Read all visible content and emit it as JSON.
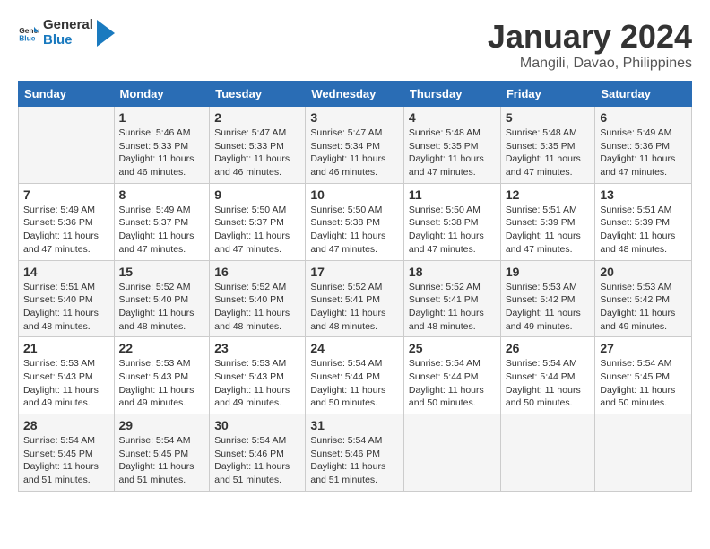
{
  "logo": {
    "text_general": "General",
    "text_blue": "Blue"
  },
  "title": "January 2024",
  "subtitle": "Mangili, Davao, Philippines",
  "days_of_week": [
    "Sunday",
    "Monday",
    "Tuesday",
    "Wednesday",
    "Thursday",
    "Friday",
    "Saturday"
  ],
  "weeks": [
    [
      {
        "day": "",
        "info": ""
      },
      {
        "day": "1",
        "info": "Sunrise: 5:46 AM\nSunset: 5:33 PM\nDaylight: 11 hours\nand 46 minutes."
      },
      {
        "day": "2",
        "info": "Sunrise: 5:47 AM\nSunset: 5:33 PM\nDaylight: 11 hours\nand 46 minutes."
      },
      {
        "day": "3",
        "info": "Sunrise: 5:47 AM\nSunset: 5:34 PM\nDaylight: 11 hours\nand 46 minutes."
      },
      {
        "day": "4",
        "info": "Sunrise: 5:48 AM\nSunset: 5:35 PM\nDaylight: 11 hours\nand 47 minutes."
      },
      {
        "day": "5",
        "info": "Sunrise: 5:48 AM\nSunset: 5:35 PM\nDaylight: 11 hours\nand 47 minutes."
      },
      {
        "day": "6",
        "info": "Sunrise: 5:49 AM\nSunset: 5:36 PM\nDaylight: 11 hours\nand 47 minutes."
      }
    ],
    [
      {
        "day": "7",
        "info": "Sunrise: 5:49 AM\nSunset: 5:36 PM\nDaylight: 11 hours\nand 47 minutes."
      },
      {
        "day": "8",
        "info": "Sunrise: 5:49 AM\nSunset: 5:37 PM\nDaylight: 11 hours\nand 47 minutes."
      },
      {
        "day": "9",
        "info": "Sunrise: 5:50 AM\nSunset: 5:37 PM\nDaylight: 11 hours\nand 47 minutes."
      },
      {
        "day": "10",
        "info": "Sunrise: 5:50 AM\nSunset: 5:38 PM\nDaylight: 11 hours\nand 47 minutes."
      },
      {
        "day": "11",
        "info": "Sunrise: 5:50 AM\nSunset: 5:38 PM\nDaylight: 11 hours\nand 47 minutes."
      },
      {
        "day": "12",
        "info": "Sunrise: 5:51 AM\nSunset: 5:39 PM\nDaylight: 11 hours\nand 47 minutes."
      },
      {
        "day": "13",
        "info": "Sunrise: 5:51 AM\nSunset: 5:39 PM\nDaylight: 11 hours\nand 48 minutes."
      }
    ],
    [
      {
        "day": "14",
        "info": "Sunrise: 5:51 AM\nSunset: 5:40 PM\nDaylight: 11 hours\nand 48 minutes."
      },
      {
        "day": "15",
        "info": "Sunrise: 5:52 AM\nSunset: 5:40 PM\nDaylight: 11 hours\nand 48 minutes."
      },
      {
        "day": "16",
        "info": "Sunrise: 5:52 AM\nSunset: 5:40 PM\nDaylight: 11 hours\nand 48 minutes."
      },
      {
        "day": "17",
        "info": "Sunrise: 5:52 AM\nSunset: 5:41 PM\nDaylight: 11 hours\nand 48 minutes."
      },
      {
        "day": "18",
        "info": "Sunrise: 5:52 AM\nSunset: 5:41 PM\nDaylight: 11 hours\nand 48 minutes."
      },
      {
        "day": "19",
        "info": "Sunrise: 5:53 AM\nSunset: 5:42 PM\nDaylight: 11 hours\nand 49 minutes."
      },
      {
        "day": "20",
        "info": "Sunrise: 5:53 AM\nSunset: 5:42 PM\nDaylight: 11 hours\nand 49 minutes."
      }
    ],
    [
      {
        "day": "21",
        "info": "Sunrise: 5:53 AM\nSunset: 5:43 PM\nDaylight: 11 hours\nand 49 minutes."
      },
      {
        "day": "22",
        "info": "Sunrise: 5:53 AM\nSunset: 5:43 PM\nDaylight: 11 hours\nand 49 minutes."
      },
      {
        "day": "23",
        "info": "Sunrise: 5:53 AM\nSunset: 5:43 PM\nDaylight: 11 hours\nand 49 minutes."
      },
      {
        "day": "24",
        "info": "Sunrise: 5:54 AM\nSunset: 5:44 PM\nDaylight: 11 hours\nand 50 minutes."
      },
      {
        "day": "25",
        "info": "Sunrise: 5:54 AM\nSunset: 5:44 PM\nDaylight: 11 hours\nand 50 minutes."
      },
      {
        "day": "26",
        "info": "Sunrise: 5:54 AM\nSunset: 5:44 PM\nDaylight: 11 hours\nand 50 minutes."
      },
      {
        "day": "27",
        "info": "Sunrise: 5:54 AM\nSunset: 5:45 PM\nDaylight: 11 hours\nand 50 minutes."
      }
    ],
    [
      {
        "day": "28",
        "info": "Sunrise: 5:54 AM\nSunset: 5:45 PM\nDaylight: 11 hours\nand 51 minutes."
      },
      {
        "day": "29",
        "info": "Sunrise: 5:54 AM\nSunset: 5:45 PM\nDaylight: 11 hours\nand 51 minutes."
      },
      {
        "day": "30",
        "info": "Sunrise: 5:54 AM\nSunset: 5:46 PM\nDaylight: 11 hours\nand 51 minutes."
      },
      {
        "day": "31",
        "info": "Sunrise: 5:54 AM\nSunset: 5:46 PM\nDaylight: 11 hours\nand 51 minutes."
      },
      {
        "day": "",
        "info": ""
      },
      {
        "day": "",
        "info": ""
      },
      {
        "day": "",
        "info": ""
      }
    ]
  ]
}
